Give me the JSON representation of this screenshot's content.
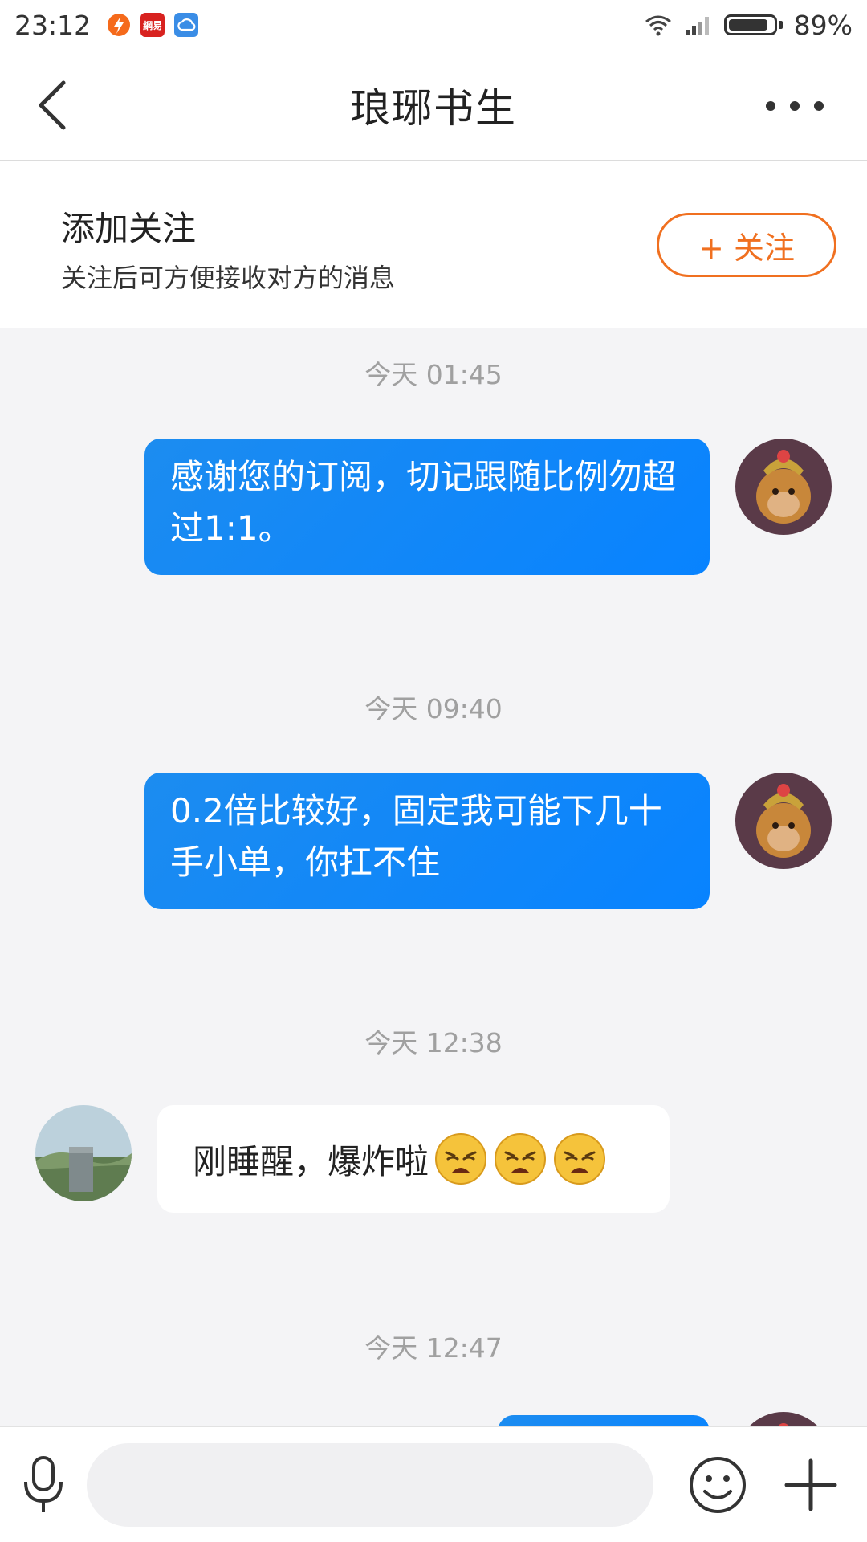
{
  "status_bar": {
    "time": "23:12",
    "app_icons": [
      "flash-app-icon",
      "netease-app-icon",
      "cloud-app-icon"
    ],
    "app_icon_text": {
      "netease": "網易"
    },
    "battery_percent": "89%",
    "battery_level": 0.89,
    "icons": [
      "wifi-icon",
      "signal-icon",
      "battery-icon"
    ]
  },
  "header": {
    "title": "琅琊书生",
    "back_icon": "chevron-left-icon",
    "more_icon": "more-dots-icon"
  },
  "follow_banner": {
    "heading": "添加关注",
    "subtext": "关注后可方便接收对方的消息",
    "button_label": "+ 关注",
    "accent": "#f07020"
  },
  "messages": [
    {
      "timestamp": "今天 01:45",
      "direction": "out",
      "text": "感谢您的订阅，切记跟随比例勿超过1:1。"
    },
    {
      "timestamp": "今天 09:40",
      "direction": "out",
      "text": "0.2倍比较好，固定我可能下几十手小单，你扛不住"
    },
    {
      "timestamp": "今天 12:38",
      "direction": "in",
      "text": "刚睡醒，爆炸啦",
      "emoji": [
        "weary-face-emoji",
        "weary-face-emoji",
        "weary-face-emoji"
      ]
    },
    {
      "timestamp": "今天 12:47",
      "direction": "out",
      "text": ""
    }
  ],
  "input_bar": {
    "placeholder": "",
    "icons": [
      "microphone-icon",
      "smiley-icon",
      "plus-icon"
    ]
  },
  "colors": {
    "bubble_out": "#0883ff",
    "bubble_in": "#ffffff",
    "chat_background": "#f4f4f6",
    "timestamp": "#a0a0a0"
  }
}
